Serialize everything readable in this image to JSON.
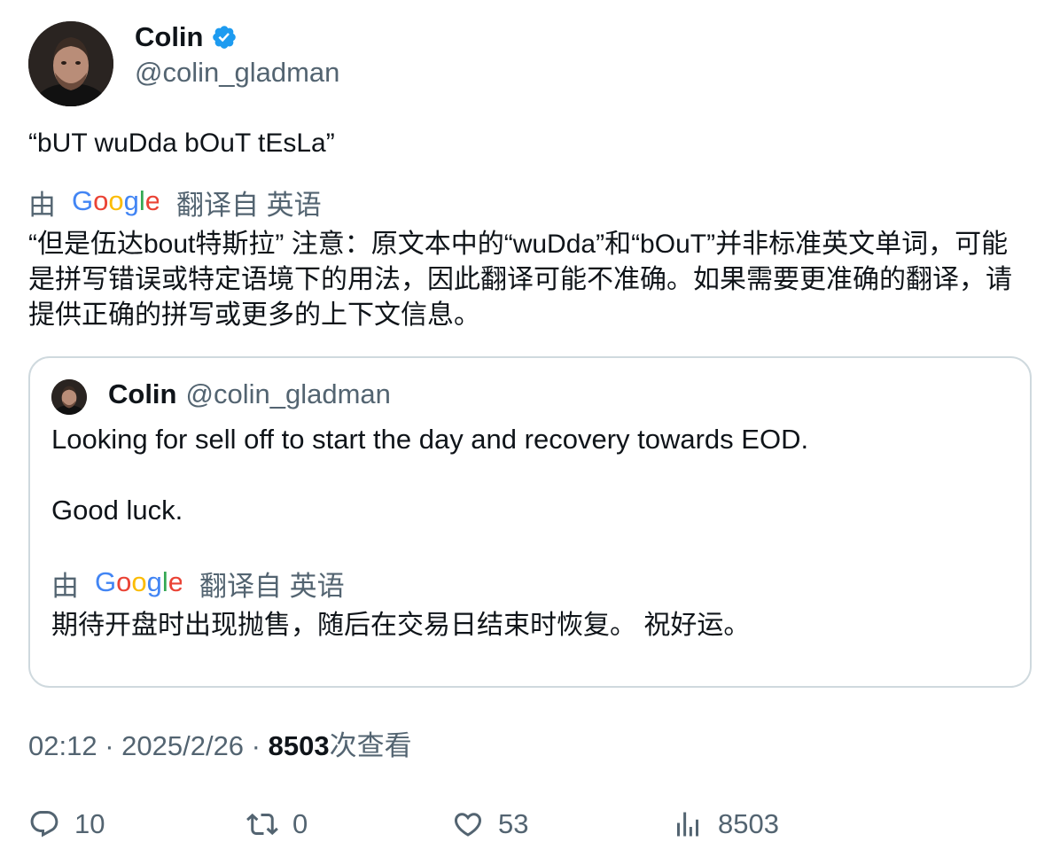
{
  "author": {
    "display_name": "Colin",
    "handle": "@colin_gladman",
    "verified": true
  },
  "tweet": {
    "text": "“bUT wuDda bOuT tEsLa”",
    "translation": {
      "by_label": "由",
      "provider": "Google",
      "from_label": "翻译自 英语",
      "text": "“但是伍达bout特斯拉” 注意：原文本中的“wuDda”和“bOuT”并非标准英文单词，可能是拼写错误或特定语境下的用法，因此翻译可能不准确。如果需要更准确的翻译，请提供正确的拼写或更多的上下文信息。"
    }
  },
  "quote": {
    "display_name": "Colin",
    "handle": "@colin_gladman",
    "text_line1": "Looking for sell off to start the day and recovery towards EOD.",
    "text_line2": "Good luck.",
    "translation": {
      "by_label": "由",
      "provider": "Google",
      "from_label": "翻译自 英语",
      "text": "期待开盘时出现抛售，随后在交易日结束时恢复。 祝好运。"
    }
  },
  "meta": {
    "time": "02:12",
    "separator": " · ",
    "date": "2025/2/26",
    "views_count": "8503",
    "views_label": "次查看"
  },
  "actions": {
    "replies": "10",
    "retweets": "0",
    "likes": "53",
    "views": "8503"
  },
  "colors": {
    "text": "#0f1419",
    "secondary": "#536471",
    "verified": "#1d9bf0",
    "border": "#cfd9de",
    "google_blue": "#4285F4",
    "google_red": "#EA4335",
    "google_yellow": "#FBBC05",
    "google_green": "#34A853"
  }
}
